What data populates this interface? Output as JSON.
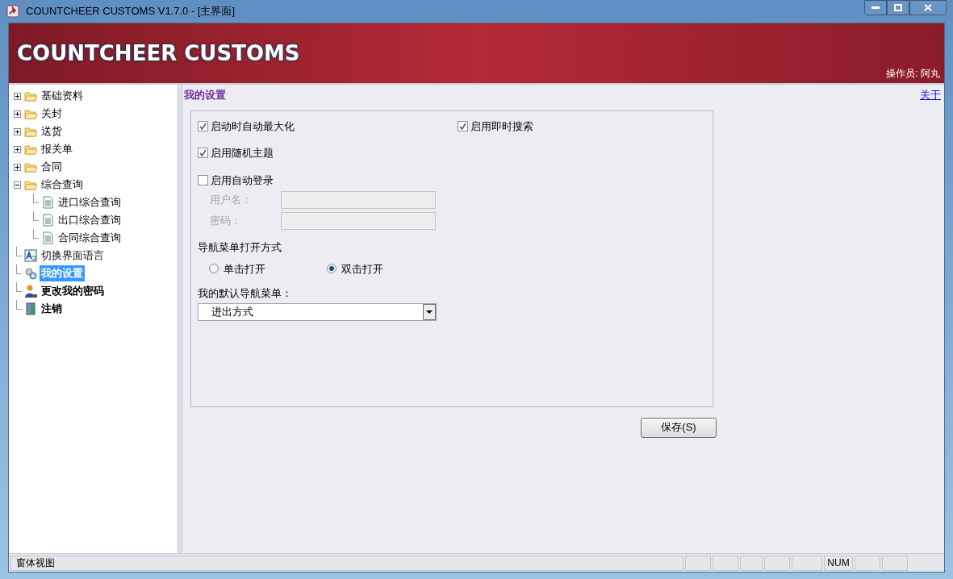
{
  "window": {
    "title": "COUNTCHEER CUSTOMS V1.7.0 - [主界面]"
  },
  "banner": {
    "title": "COUNTCHEER CUSTOMS",
    "operator": "操作员: 阿丸"
  },
  "sidebar": {
    "tree": [
      {
        "label": "基础资料",
        "kind": "folder",
        "expanded": false,
        "selected": false,
        "bold": false
      },
      {
        "label": "关封",
        "kind": "folder",
        "expanded": false,
        "selected": false,
        "bold": false
      },
      {
        "label": "送货",
        "kind": "folder",
        "expanded": false,
        "selected": false,
        "bold": false
      },
      {
        "label": "报关单",
        "kind": "folder",
        "expanded": false,
        "selected": false,
        "bold": false
      },
      {
        "label": "合同",
        "kind": "folder",
        "expanded": false,
        "selected": false,
        "bold": false
      },
      {
        "label": "综合查询",
        "kind": "folder",
        "expanded": true,
        "selected": false,
        "bold": false,
        "children": [
          {
            "label": "进口综合查询",
            "kind": "document",
            "selected": false,
            "bold": false
          },
          {
            "label": "出口综合查询",
            "kind": "document",
            "selected": false,
            "bold": false
          },
          {
            "label": "合同综合查询",
            "kind": "document",
            "selected": false,
            "bold": false
          }
        ]
      },
      {
        "label": "切换界面语言",
        "kind": "language",
        "selected": false,
        "bold": false
      },
      {
        "label": "我的设置",
        "kind": "gears",
        "selected": true,
        "bold": true
      },
      {
        "label": "更改我的密码",
        "kind": "user",
        "selected": false,
        "bold": true
      },
      {
        "label": "注销",
        "kind": "door",
        "selected": false,
        "bold": true
      }
    ]
  },
  "main": {
    "heading": "我的设置",
    "about_link": "关于",
    "options": [
      {
        "label": "启动时自动最大化",
        "checked": true
      },
      {
        "label": "启用即时搜索",
        "checked": true
      },
      {
        "label": "启用随机主题",
        "checked": true
      },
      {
        "label": "启用自动登录",
        "checked": false
      }
    ],
    "login_fields": [
      {
        "label": "用户名：",
        "disabled": true
      },
      {
        "label": "密码：",
        "disabled": true
      }
    ],
    "nav_open_mode": {
      "label": "导航菜单打开方式",
      "choices": [
        {
          "label": "单击打开",
          "selected": false
        },
        {
          "label": "双击打开",
          "selected": true
        }
      ]
    },
    "default_menu": {
      "label": "我的默认导航菜单：",
      "value": "进出方式"
    },
    "save_button": "保存(S)"
  },
  "status_bar": {
    "left": "窗体视图",
    "indicator": "NUM"
  }
}
